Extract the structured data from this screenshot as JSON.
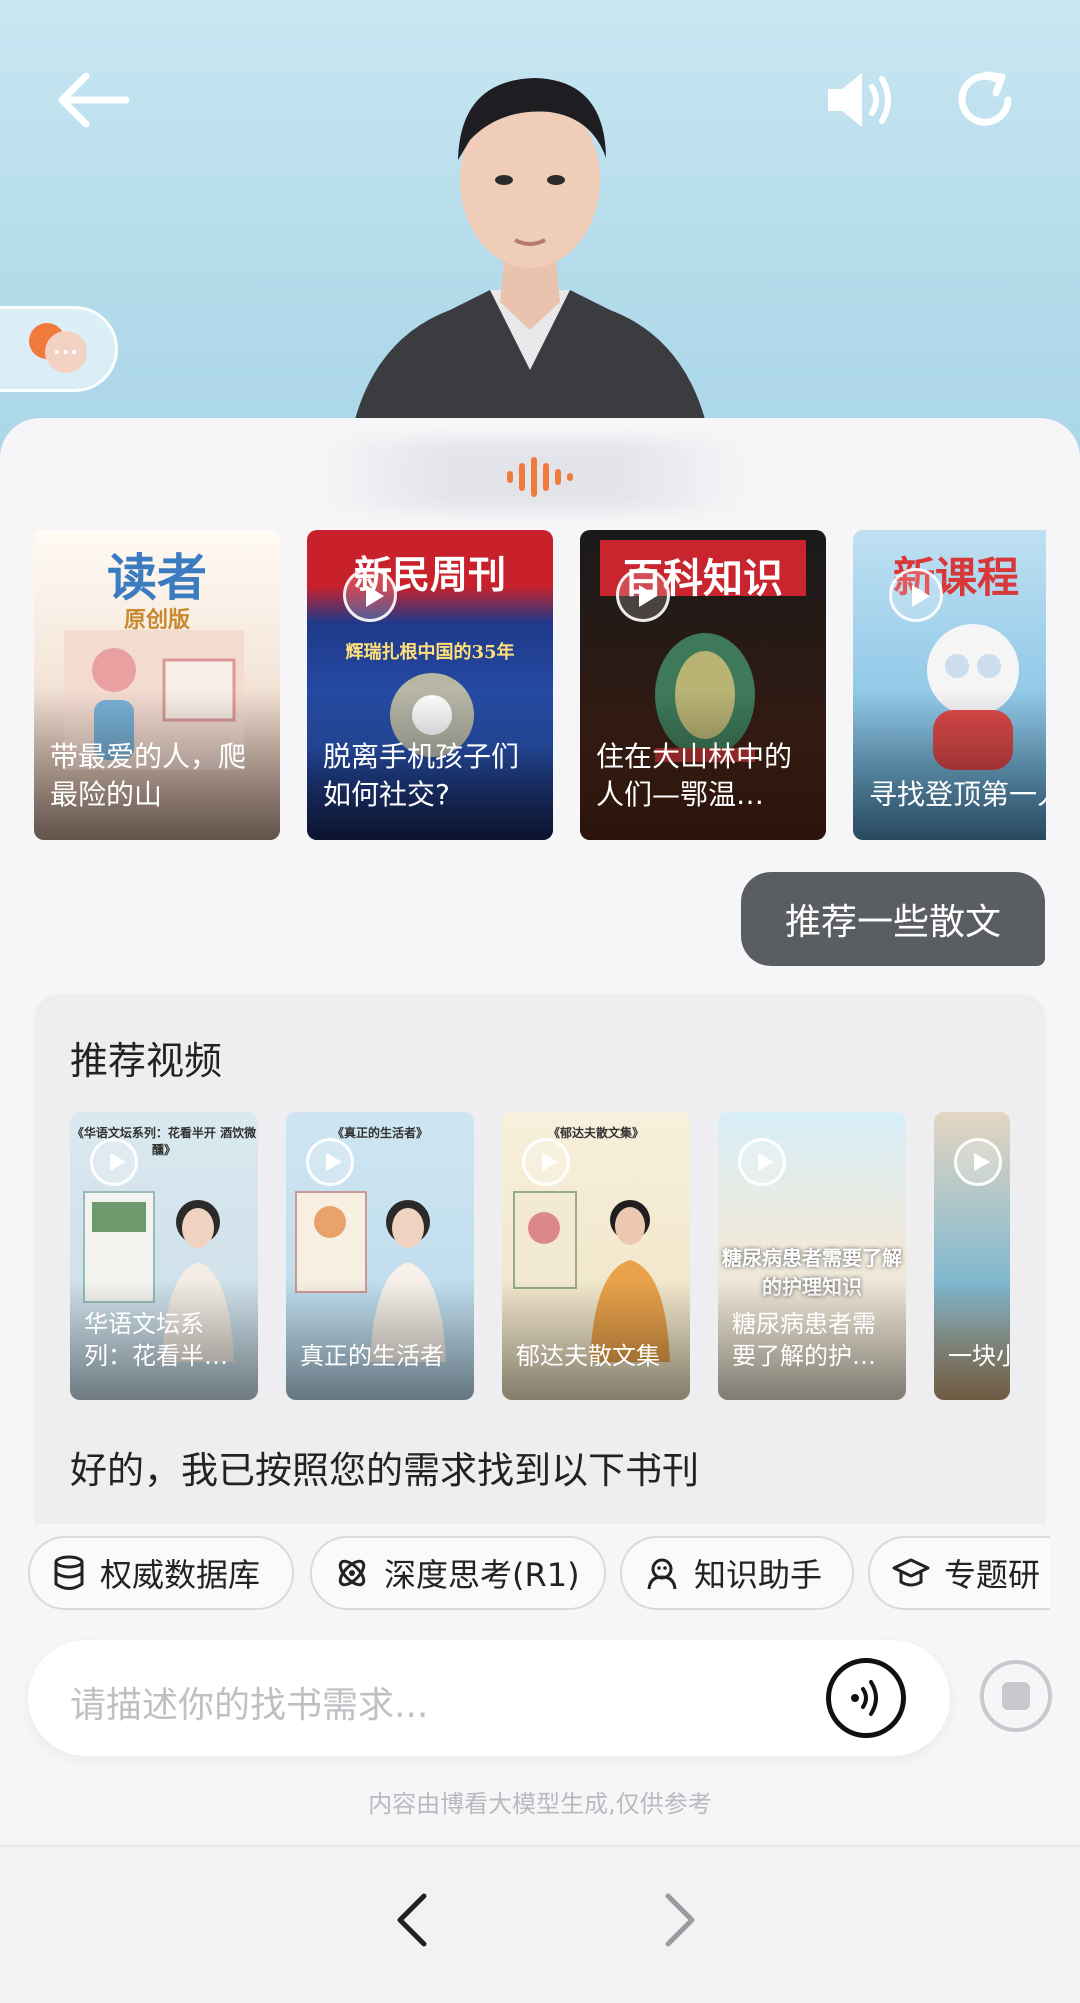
{
  "header": {
    "back_icon": "arrow-left-icon",
    "sound_icon": "speaker-icon",
    "refresh_icon": "refresh-icon",
    "bubble_text": "···"
  },
  "magazines": [
    {
      "masthead": "读者",
      "sub": "原创版",
      "caption": "带最爱的人，爬最险的山",
      "has_play": false
    },
    {
      "masthead": "新民周刊",
      "sub": "辉瑞扎根中国的35年",
      "caption": "脱离手机孩子们如何社交?",
      "has_play": true
    },
    {
      "masthead": "百科知识",
      "sub": "",
      "caption": "住在大山林中的人们—鄂温…",
      "has_play": true
    },
    {
      "masthead": "新课程",
      "sub": "",
      "caption": "寻找登顶第一人",
      "has_play": true
    }
  ],
  "user_message": "推荐一些散文",
  "recommend": {
    "title": "推荐视频",
    "videos": [
      {
        "top": "《华语文坛系列：花看半开 酒饮微醺》",
        "caption": "华语文坛系列：花看半…"
      },
      {
        "top": "《真正的生活者》",
        "caption": "真正的生活者"
      },
      {
        "top": "《郁达夫散文集》",
        "caption": "郁达夫散文集"
      },
      {
        "top": "糖尿病患者需要了解的护理知识",
        "caption": "糖尿病患者需要了解的护…"
      },
      {
        "top": "",
        "caption": "一块小发的大"
      }
    ]
  },
  "answer_text": "好的，我已按照您的需求找到以下书刊",
  "chips": [
    {
      "label": "权威数据库",
      "icon": "database-icon"
    },
    {
      "label": "深度思考(R1)",
      "icon": "atom-icon"
    },
    {
      "label": "知识助手",
      "icon": "assistant-icon"
    },
    {
      "label": "专题研",
      "icon": "graduation-cap-icon"
    }
  ],
  "input": {
    "placeholder": "请描述你的找书需求..."
  },
  "disclaimer": "内容由博看大模型生成,仅供参考",
  "colors": {
    "user_bubble": "#5a5d61",
    "accent": "#f07a3c",
    "hero_bg": "#b4dceb"
  }
}
